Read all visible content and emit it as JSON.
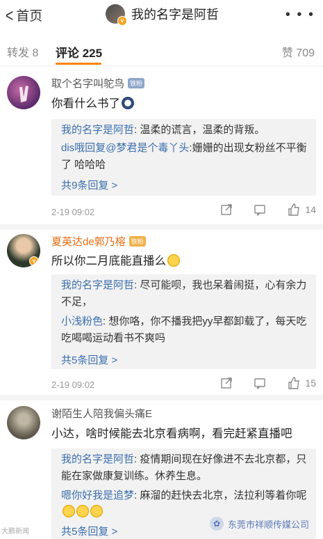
{
  "header": {
    "back_label": "首页",
    "title": "我的名字是阿哲",
    "more_glyph": "• • •"
  },
  "tabs": {
    "repost": "转发 8",
    "comments": "评论 225",
    "likes": "赞 709"
  },
  "comments": [
    {
      "username": "取个名字叫鸵鸟",
      "badge": "铁粉",
      "text": "你看什么书了",
      "replies": [
        {
          "who": "我的名字是阿哲",
          "text": ": 温柔的谎言，温柔的背叛。"
        },
        {
          "who": "dis哦回复@梦君是个毒丫头",
          "text": ":姗姗的出现女粉丝不平衡了 哈哈哈"
        }
      ],
      "more": "共9条回复 >",
      "time": "2-19 09:02",
      "likes": "14"
    },
    {
      "username": "夏英达de郭乃榕",
      "badge": "铁粉",
      "text": "所以你二月底能直播么",
      "replies": [
        {
          "who": "我的名字是阿哲",
          "text": ": 尽可能呗，我也呆着闹挺，心有余力不足，"
        },
        {
          "who": "小浅粉色",
          "text": ": 想你咯，你不播我把yy早都卸载了，每天吃吃喝喝运动看书不爽吗"
        }
      ],
      "more": "共5条回复 >",
      "time": "2-19 09:02",
      "likes": "15"
    },
    {
      "username": "谢陌生人陪我偏头痛E",
      "text": "小达，啥时候能去北京看病啊，看完赶紧直播吧",
      "replies": [
        {
          "who": "我的名字是阿哲",
          "text": ": 疫情期间现在好像进不去北京都，只能在家做康复训练。休养生息。"
        },
        {
          "who": "嗯你好我是追梦",
          "text": ": 麻溜的赶快去北京，法拉利等着你呢"
        }
      ],
      "more": "共5条回复 >"
    }
  ],
  "watermark": "东莞市祥顺传媒公司",
  "corner_logo": "大鹏新闻"
}
